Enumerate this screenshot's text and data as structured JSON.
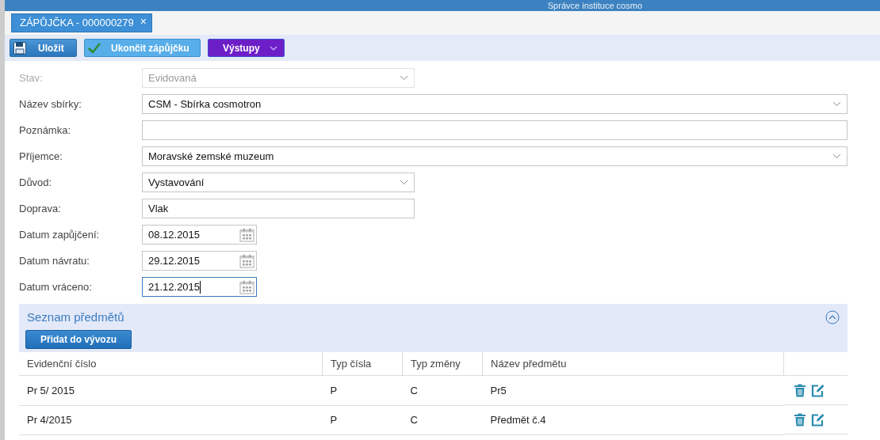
{
  "header": {
    "title": "Správce instituce cosmo"
  },
  "tabs": [
    {
      "label": "ZÁPŮJČKA - 000000279",
      "selected": true,
      "close": "×"
    }
  ],
  "toolbar": [
    {
      "label": "Uložit",
      "kind": "save"
    },
    {
      "label": "Ukončit zápůjčku",
      "kind": "finish"
    },
    {
      "label": "Výstupy",
      "kind": "menu"
    }
  ],
  "form": [
    {
      "label": "Stav:",
      "value": "Evidovaná",
      "kind": "select",
      "disabled": true,
      "focused": false
    },
    {
      "label": "Název sbírky:",
      "value": "CSM - Sbírka cosmotron",
      "kind": "select",
      "disabled": false,
      "focused": false
    },
    {
      "label": "Poznámka:",
      "kind": "text",
      "disabled": false,
      "focused": false
    },
    {
      "label": "Příjemce:",
      "value": "Moravské zemské muzeum",
      "kind": "select",
      "disabled": false,
      "focused": false
    },
    {
      "label": "Důvod:",
      "value": "Vystavování",
      "kind": "select",
      "disabled": false,
      "focused": false
    },
    {
      "label": "Doprava:",
      "value": "Vlak",
      "kind": "text",
      "disabled": false,
      "focused": false
    },
    {
      "label": "Datum zapůjčení:",
      "value": "08.12.2015",
      "kind": "date",
      "disabled": false,
      "focused": false
    },
    {
      "label": "Datum návratu:",
      "value": "29.12.2015",
      "kind": "date",
      "disabled": false,
      "focused": false
    },
    {
      "label": "Datum vráceno:",
      "value": "21.12.2015",
      "kind": "date",
      "disabled": false,
      "focused": true
    }
  ],
  "section": {
    "title": "Seznam předmětů",
    "expanded": true,
    "button": "Přidat do vývozu",
    "columns": [
      "Evidenční číslo",
      "Typ čísla",
      "Typ změny",
      "Název předmětu"
    ],
    "rows": [
      [
        "Pr 5/ 2015",
        "P",
        "C",
        "Pr5"
      ],
      [
        "Pr 4/2015",
        "P",
        "C",
        "Předmět č.4"
      ]
    ]
  }
}
